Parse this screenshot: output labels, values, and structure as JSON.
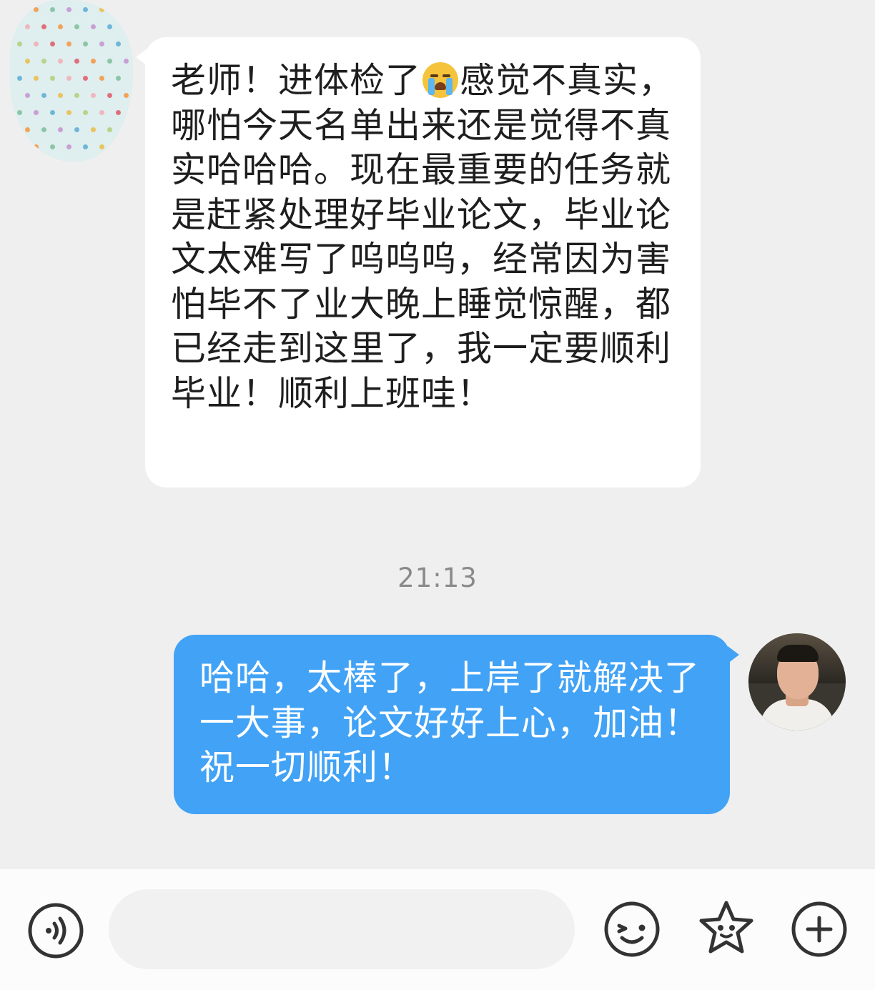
{
  "messages": {
    "incoming": {
      "text_before_emoji": "老师！进体检了",
      "emoji": "loudly-crying-face",
      "text_after_emoji": "感觉不真实，哪怕今天名单出来还是觉得不真实哈哈哈。现在最重要的任务就是赶紧处理好毕业论文，毕业论文太难写了呜呜呜，经常因为害怕毕不了业大晚上睡觉惊醒，都已经走到这里了，我一定要顺利毕业！顺利上班哇！"
    },
    "timestamp": "21:13",
    "outgoing": {
      "text": "哈哈，太棒了，上岸了就解决了一大事，论文好好上心，加油！祝一切顺利！"
    }
  },
  "composer": {
    "input_value": "",
    "icons": [
      "voice-icon",
      "emoji-icon",
      "favorites-star-icon",
      "plus-icon"
    ]
  },
  "colors": {
    "background": "#efefef",
    "incoming_bubble": "#ffffff",
    "outgoing_bubble": "#41a2f6",
    "timestamp": "#8a8a8a",
    "icon_stroke": "#333333"
  }
}
